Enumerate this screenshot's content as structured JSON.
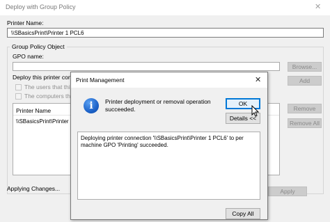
{
  "window": {
    "title": "Deploy with Group Policy",
    "close_glyph": "✕"
  },
  "printer_name": {
    "label": "Printer Name:",
    "value": "\\\\SBasicsPrint\\Printer 1 PCL6"
  },
  "gpo_group": {
    "title": "Group Policy Object",
    "gpo_name_label": "GPO name:",
    "gpo_name_value": "",
    "browse_button": "Browse...",
    "deploy_label": "Deploy this printer conn",
    "checkbox_users": "The users that this",
    "checkbox_computers": "The computers that",
    "add_button": "Add"
  },
  "printer_list": {
    "header": "Printer Name",
    "rows": [
      "\\\\SBasicsPrint\\Printer 1"
    ],
    "remove_button": "Remove",
    "remove_all_button": "Remove All"
  },
  "status_text": "Applying Changes...",
  "apply_button": "Apply",
  "modal": {
    "title": "Print Management",
    "close_glyph": "✕",
    "icon": "info-icon",
    "message": "Printer deployment or removal operation succeeded.",
    "ok_button": "OK",
    "details_button": "Details <<",
    "details_text": "Deploying printer connection '\\\\SBasicsPrint\\Printer 1 PCL6' to per machine GPO 'Printing' succeeded.",
    "copy_all_button": "Copy All"
  },
  "colors": {
    "dialog_bg": "#f0f0f0",
    "ok_focus_border": "#0078d7",
    "info_blue": "#1d63c9"
  }
}
